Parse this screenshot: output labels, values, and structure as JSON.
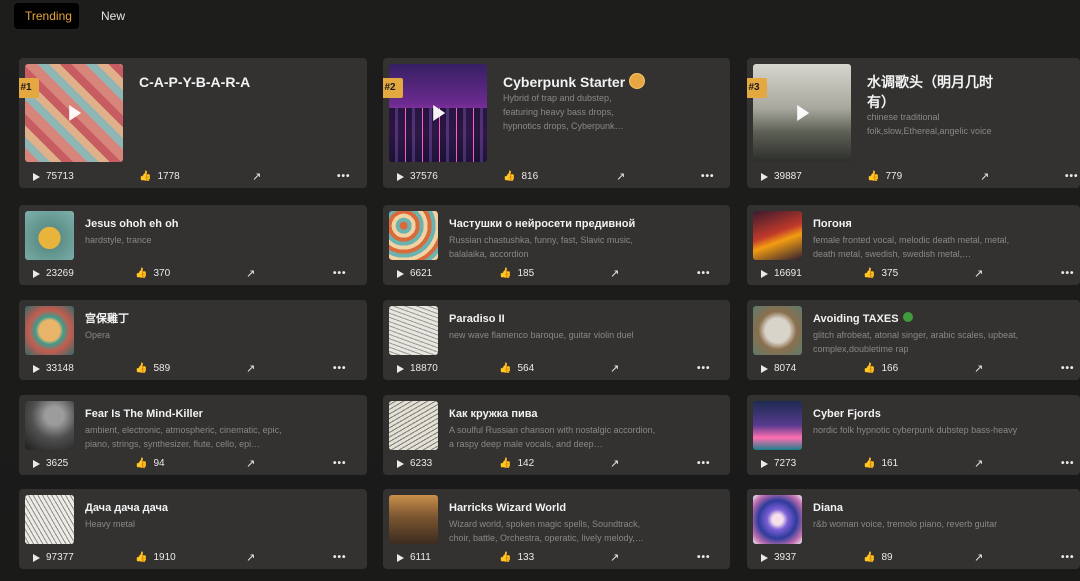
{
  "tabs": [
    {
      "label": "Trending",
      "active": true
    },
    {
      "label": "New",
      "active": false
    }
  ],
  "colors": {
    "accent": "#e4a841",
    "card": "#333231",
    "background": "#1c1c1b"
  },
  "featured": [
    {
      "rank": "#1",
      "title": "C-A-P-Y-B-A-R-A",
      "description": "",
      "plays": "75713",
      "likes": "1778",
      "thumb": "capybara-pattern"
    },
    {
      "rank": "#2",
      "title": "Cyberpunk Starter",
      "description": "Hybrid of trap and dubstep, featuring heavy bass drops, hypnotics drops, Cyberpunk…",
      "plays": "37576",
      "likes": "816",
      "thumb": "cyberpunk-city",
      "emoji": "radioactive-icon"
    },
    {
      "rank": "#3",
      "title": "水调歌头（明月几时有）",
      "description": "chinese traditional folk,slow,Ethereal,angelic voice",
      "plays": "39887",
      "likes": "779",
      "thumb": "chinese-landscape"
    }
  ],
  "songs": [
    {
      "title": "Jesus ohoh eh oh",
      "description": "hardstyle, trance",
      "plays": "23269",
      "likes": "370",
      "thumb": "bird-illustration"
    },
    {
      "title": "Частушки о нейросети предивной",
      "description": "Russian chastushka, funny, fast, Slavic music, balalaika, accordion",
      "plays": "6621",
      "likes": "185",
      "thumb": "folk-pattern"
    },
    {
      "title": "Погоня",
      "description": "female fronted vocal, melodic death metal, metal, death metal, swedish, swedish metal,…",
      "plays": "16691",
      "likes": "375",
      "thumb": "fire-landscape"
    },
    {
      "title": "宫保雞丁",
      "description": "Opera",
      "plays": "33148",
      "likes": "589",
      "thumb": "mask-face"
    },
    {
      "title": "Paradiso II",
      "description": "new wave flamenco baroque, guitar violin duel",
      "plays": "18870",
      "likes": "564",
      "thumb": "bird-sketch"
    },
    {
      "title": "Avoiding TAXES",
      "description": "glitch afrobeat, atonal singer, arabic scales, upbeat, complex,doubletime rap",
      "plays": "8074",
      "likes": "166",
      "thumb": "bird-guitar",
      "emoji": "tree-icon"
    },
    {
      "title": "Fear Is The Mind-Killer",
      "description": "ambient, electronic, atmospheric, cinematic, epic, piano, strings, synthesizer, flute, cello, epi…",
      "plays": "3625",
      "likes": "94",
      "thumb": "lone-tree"
    },
    {
      "title": "Как кружка пива",
      "description": "A soulful Russian chanson with nostalgic accordion, a raspy deep male vocals, and deep…",
      "plays": "6233",
      "likes": "142",
      "thumb": "bird-engraving"
    },
    {
      "title": "Cyber Fjords",
      "description": "nordic folk hypnotic cyberpunk dubstep bass-heavy",
      "plays": "7273",
      "likes": "161",
      "thumb": "neon-forest"
    },
    {
      "title": "Дача дача дача",
      "description": "Heavy metal",
      "plays": "97377",
      "likes": "1910",
      "thumb": "bird-sketch-2"
    },
    {
      "title": "Harricks Wizard World",
      "description": "Wizard world, spoken magic spells, Soundtrack, choir, battle, Orchestra, operatic, lively melody,…",
      "plays": "6111",
      "likes": "133",
      "thumb": "castle"
    },
    {
      "title": "Diana",
      "description": "r&b woman voice, tremolo piano, reverb guitar",
      "plays": "3937",
      "likes": "89",
      "thumb": "swirl"
    }
  ],
  "more_label": "•••"
}
